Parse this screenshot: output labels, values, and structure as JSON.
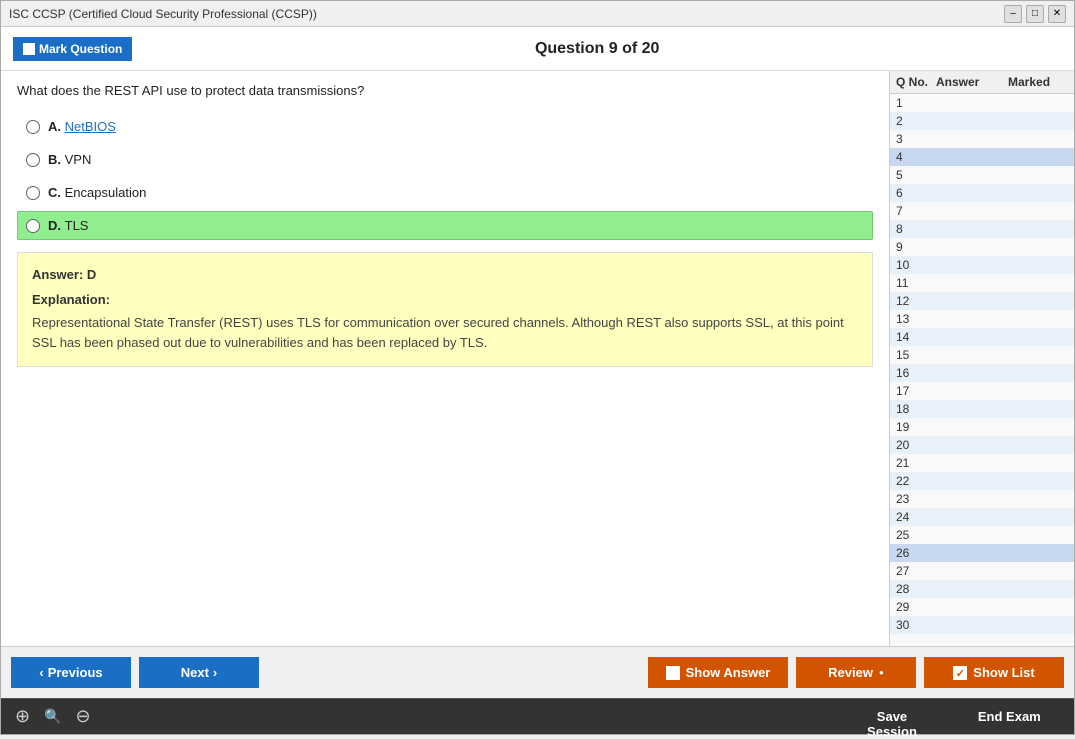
{
  "titleBar": {
    "title": "ISC CCSP (Certified Cloud Security Professional (CCSP))",
    "titleHighlight": "CCSP",
    "minimize": "–",
    "maximize": "□",
    "close": "✕"
  },
  "toolbar": {
    "markQuestion": "Mark Question",
    "questionTitle": "Question 9 of 20"
  },
  "question": {
    "text": "What does the REST API use to protect data transmissions?",
    "options": [
      {
        "id": "A",
        "letter": "A.",
        "text": "NetBIOS",
        "linked": true,
        "selected": false
      },
      {
        "id": "B",
        "letter": "B.",
        "text": "VPN",
        "linked": false,
        "selected": false
      },
      {
        "id": "C",
        "letter": "C.",
        "text": "Encapsulation",
        "linked": false,
        "selected": false
      },
      {
        "id": "D",
        "letter": "D.",
        "text": "TLS",
        "linked": false,
        "selected": true
      }
    ]
  },
  "answerBox": {
    "answerLabel": "Answer: D",
    "explanationLabel": "Explanation:",
    "explanationText": "Representational State Transfer (REST) uses TLS for communication over secured channels. Although REST also supports SSL, at this point SSL has been phased out due to vulnerabilities and has been replaced by TLS."
  },
  "sidebar": {
    "headers": [
      "Q No.",
      "Answer",
      "Marked"
    ],
    "rows": [
      1,
      2,
      3,
      4,
      5,
      6,
      7,
      8,
      9,
      10,
      11,
      12,
      13,
      14,
      15,
      16,
      17,
      18,
      19,
      20,
      21,
      22,
      23,
      24,
      25,
      26,
      27,
      28,
      29,
      30
    ]
  },
  "buttons": {
    "previous": "Previous",
    "next": "Next",
    "showAnswer": "Show Answer",
    "review": "Review",
    "reviewDot": "●",
    "showList": "Show List",
    "saveSession": "Save Session",
    "endExam": "End Exam"
  },
  "zoom": {
    "zoomIn": "⊕",
    "zoomNormal": "🔍",
    "zoomOut": "⊖"
  }
}
